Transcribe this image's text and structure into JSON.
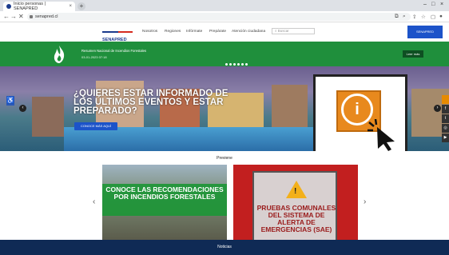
{
  "browser": {
    "tab_title": "Inicio personas | SENAPRED",
    "tab_close": "×",
    "new_tab": "+",
    "url": "senapred.cl",
    "back": "←",
    "forward": "→",
    "reload": "✕"
  },
  "header": {
    "logo_text": "SENAPRED",
    "nav": [
      "Nosotros",
      "Regiones",
      "Infórmate",
      "Prepárate",
      "Atención ciudadana"
    ],
    "search_placeholder": "Buscar",
    "right_button": "SENAPRED"
  },
  "banner": {
    "title": "Resumen Nacional de Incendios Forestales",
    "date": "03-01-2023 07:18",
    "button": "Leer más"
  },
  "hero": {
    "title": "¿QUIERES ESTAR INFORMADO DE LOS ÚLTIMOS EVENTOS Y ESTAR PREPARADO?",
    "button": "CONOCE MÁS AQUÍ",
    "info_symbol": "i"
  },
  "previene": {
    "heading": "Previene",
    "card1": "CONOCE LAS RECOMENDACIONES POR INCENDIOS FORESTALES",
    "card2": "PRUEBAS COMUNALES DEL SISTEMA DE ALERTA DE EMERGENCIAS (SAE)",
    "prev": "‹",
    "next": "›"
  },
  "noticias": {
    "heading": "Noticias"
  },
  "colors": {
    "brand_blue": "#1c53c9",
    "green": "#1f8f3c",
    "navy": "#0f2a55",
    "red": "#c21f1f",
    "orange": "#e8891d"
  }
}
